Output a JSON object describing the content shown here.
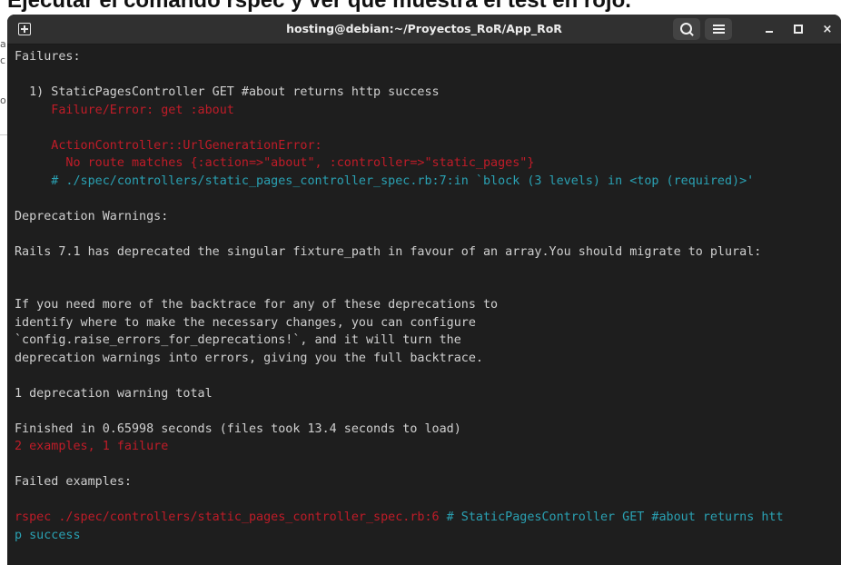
{
  "background_page": {
    "heading": "Ejecutar el comando rspec y ver que muestra el test en rojo.",
    "fragments": [
      "a",
      "c",
      "o"
    ]
  },
  "window": {
    "title": "hosting@debian:~/Proyectos_RoR/App_RoR",
    "buttons": {
      "new_tab": "new-tab-icon",
      "search": "search-icon",
      "menu": "hamburger-menu-icon",
      "minimize": "minimize-icon",
      "maximize": "maximize-icon",
      "close": "×"
    }
  },
  "colors": {
    "terminal_bg": "#1e1e1e",
    "titlebar_bg": "#303030",
    "default_text": "#d0d0d0",
    "error_red": "#c01c28",
    "comment_cyan": "#2aa1b3"
  },
  "terminal": {
    "lines": [
      [
        {
          "t": "Failures:",
          "c": "default"
        }
      ],
      [],
      [
        {
          "t": "  1) StaticPagesController GET #about returns http success",
          "c": "default"
        }
      ],
      [
        {
          "t": "     Failure/Error: get :about",
          "c": "red"
        }
      ],
      [],
      [
        {
          "t": "     ActionController::UrlGenerationError:",
          "c": "red"
        }
      ],
      [
        {
          "t": "       No route matches {:action=>\"about\", :controller=>\"static_pages\"}",
          "c": "red"
        }
      ],
      [
        {
          "t": "     # ./spec/controllers/static_pages_controller_spec.rb:7:in `block (3 levels) in <top (required)>'",
          "c": "cyan"
        }
      ],
      [],
      [
        {
          "t": "Deprecation Warnings:",
          "c": "default"
        }
      ],
      [],
      [
        {
          "t": "Rails 7.1 has deprecated the singular fixture_path in favour of an array.You should migrate to plural:",
          "c": "default"
        }
      ],
      [],
      [],
      [
        {
          "t": "If you need more of the backtrace for any of these deprecations to",
          "c": "default"
        }
      ],
      [
        {
          "t": "identify where to make the necessary changes, you can configure",
          "c": "default"
        }
      ],
      [
        {
          "t": "`config.raise_errors_for_deprecations!`, and it will turn the",
          "c": "default"
        }
      ],
      [
        {
          "t": "deprecation warnings into errors, giving you the full backtrace.",
          "c": "default"
        }
      ],
      [],
      [
        {
          "t": "1 deprecation warning total",
          "c": "default"
        }
      ],
      [],
      [
        {
          "t": "Finished in 0.65998 seconds (files took 13.4 seconds to load)",
          "c": "default"
        }
      ],
      [
        {
          "t": "2 examples, 1 failure",
          "c": "red"
        }
      ],
      [],
      [
        {
          "t": "Failed examples:",
          "c": "default"
        }
      ],
      [],
      [
        {
          "t": "rspec ./spec/controllers/static_pages_controller_spec.rb:6",
          "c": "red"
        },
        {
          "t": " # StaticPagesController GET #about returns htt",
          "c": "cyan"
        }
      ],
      [
        {
          "t": "p success",
          "c": "cyan"
        }
      ]
    ]
  }
}
